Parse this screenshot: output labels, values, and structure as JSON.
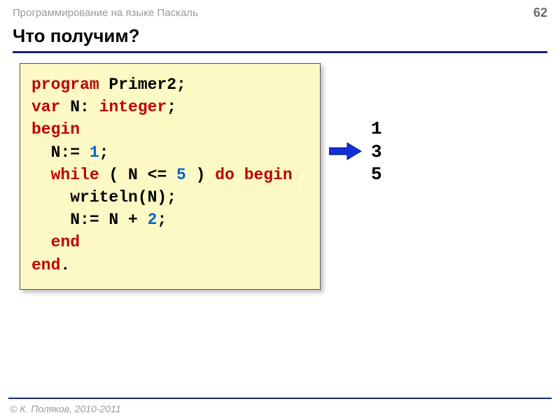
{
  "header": {
    "subject": "Программирование на языке Паскаль",
    "page": "62"
  },
  "title": "Что получим?",
  "code": {
    "tokens": [
      [
        {
          "t": "program",
          "c": "kw"
        },
        {
          "t": " Primer2;",
          "c": "txt"
        }
      ],
      [
        {
          "t": "var",
          "c": "kw"
        },
        {
          "t": " N: ",
          "c": "txt"
        },
        {
          "t": "integer",
          "c": "kw"
        },
        {
          "t": ";",
          "c": "txt"
        }
      ],
      [
        {
          "t": "begin",
          "c": "kw"
        }
      ],
      [
        {
          "t": "  N:= ",
          "c": "txt"
        },
        {
          "t": "1",
          "c": "num"
        },
        {
          "t": ";",
          "c": "txt"
        }
      ],
      [
        {
          "t": "  ",
          "c": "txt"
        },
        {
          "t": "while",
          "c": "kw"
        },
        {
          "t": " ( N <= ",
          "c": "txt"
        },
        {
          "t": "5",
          "c": "num"
        },
        {
          "t": " ) ",
          "c": "txt"
        },
        {
          "t": "do begin",
          "c": "kw"
        }
      ],
      [
        {
          "t": "    writeln(N);",
          "c": "txt"
        }
      ],
      [
        {
          "t": "    N:= N + ",
          "c": "txt"
        },
        {
          "t": "2",
          "c": "num"
        },
        {
          "t": ";",
          "c": "txt"
        }
      ],
      [
        {
          "t": "  ",
          "c": "txt"
        },
        {
          "t": "end",
          "c": "kw"
        }
      ],
      [
        {
          "t": "end",
          "c": "kw"
        },
        {
          "t": ".",
          "c": "txt"
        }
      ]
    ]
  },
  "output": {
    "lines": [
      "1",
      "3",
      "5"
    ]
  },
  "footer": "© К. Поляков, 2010-2011"
}
